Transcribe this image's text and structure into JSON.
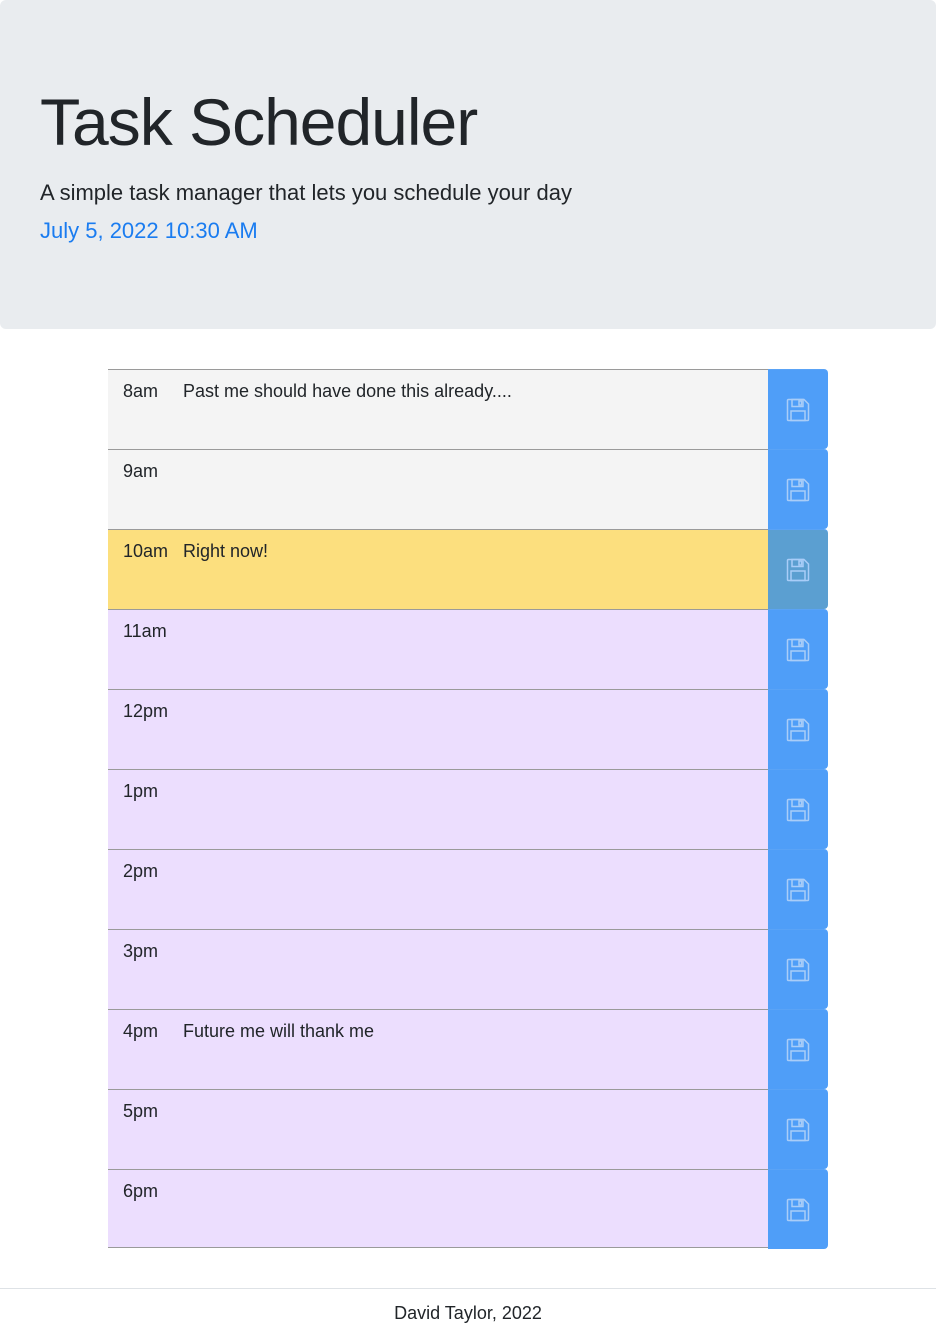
{
  "header": {
    "title": "Task Scheduler",
    "lead": "A simple task manager that lets you schedule your day",
    "current_datetime": "July 5, 2022 10:30 AM"
  },
  "colors": {
    "past": "#f4f4f4",
    "present": "#fcdf7e",
    "future": "#ecdefe",
    "save_button": "#4f9ef8",
    "save_button_present": "#5b9fd1",
    "date_accent": "#1a7cf0"
  },
  "save_icon": "floppy-disk-icon",
  "time_blocks": [
    {
      "hour": "8am",
      "state": "past",
      "description": "Past me should have done this already...."
    },
    {
      "hour": "9am",
      "state": "past",
      "description": ""
    },
    {
      "hour": "10am",
      "state": "present",
      "description": "Right now!"
    },
    {
      "hour": "11am",
      "state": "future",
      "description": ""
    },
    {
      "hour": "12pm",
      "state": "future",
      "description": ""
    },
    {
      "hour": "1pm",
      "state": "future",
      "description": ""
    },
    {
      "hour": "2pm",
      "state": "future",
      "description": ""
    },
    {
      "hour": "3pm",
      "state": "future",
      "description": ""
    },
    {
      "hour": "4pm",
      "state": "future",
      "description": "Future me will thank me"
    },
    {
      "hour": "5pm",
      "state": "future",
      "description": ""
    },
    {
      "hour": "6pm",
      "state": "future",
      "description": ""
    }
  ],
  "footer": {
    "text": "David Taylor, 2022"
  }
}
